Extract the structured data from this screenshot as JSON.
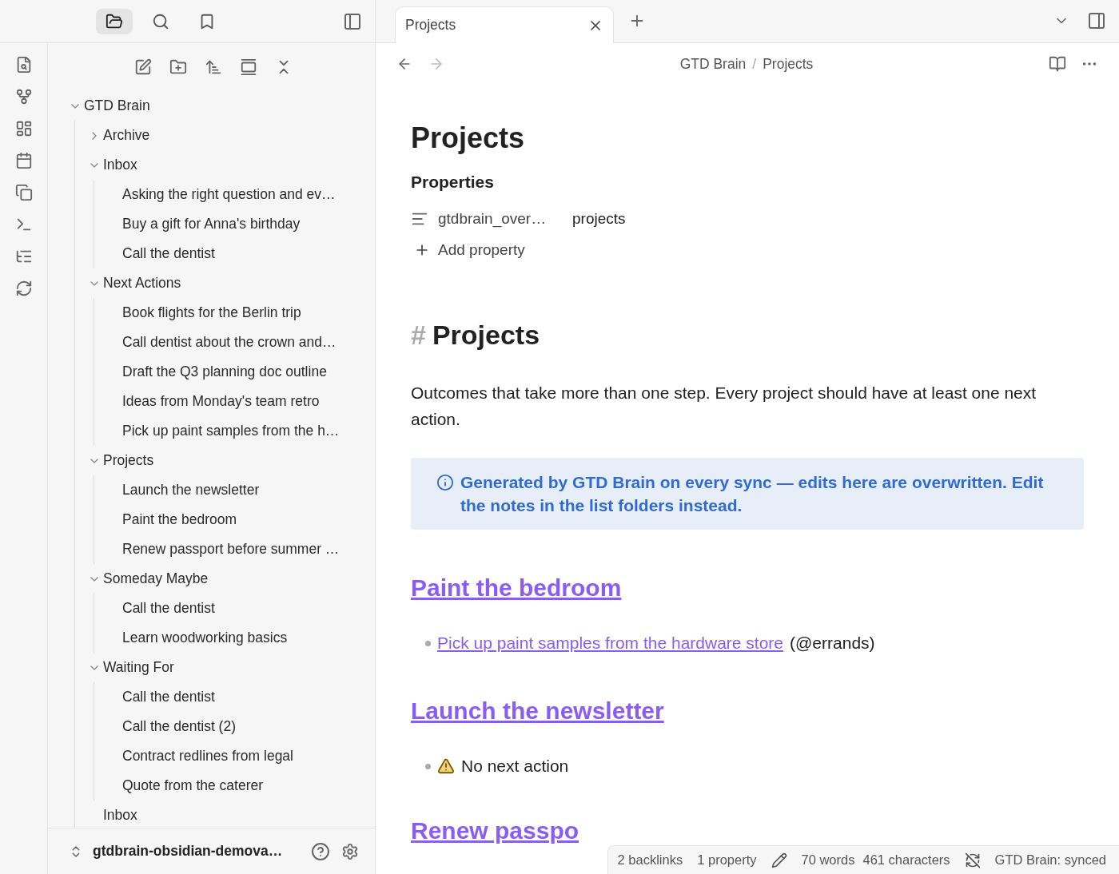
{
  "sidebar_tabs": [
    {
      "selected": true
    },
    {
      "selected": false
    },
    {
      "selected": false
    }
  ],
  "tree": [
    {
      "label": "GTD Brain",
      "kind": "folder",
      "expanded": true,
      "children": [
        {
          "label": "Archive",
          "kind": "folder",
          "expanded": false
        },
        {
          "label": "Inbox",
          "kind": "folder",
          "expanded": true,
          "children": [
            {
              "label": "Asking the right question and ev…",
              "kind": "note"
            },
            {
              "label": "Buy a gift for Anna's birthday",
              "kind": "note"
            },
            {
              "label": "Call the dentist",
              "kind": "note"
            }
          ]
        },
        {
          "label": "Next Actions",
          "kind": "folder",
          "expanded": true,
          "children": [
            {
              "label": "Book flights for the Berlin trip",
              "kind": "note"
            },
            {
              "label": "Call dentist about the crown and…",
              "kind": "note"
            },
            {
              "label": "Draft the Q3 planning doc outline",
              "kind": "note"
            },
            {
              "label": "Ideas from Monday's team retro",
              "kind": "note"
            },
            {
              "label": "Pick up paint samples from the h…",
              "kind": "note"
            }
          ]
        },
        {
          "label": "Projects",
          "kind": "folder",
          "expanded": true,
          "children": [
            {
              "label": "Launch the newsletter",
              "kind": "note"
            },
            {
              "label": "Paint the bedroom",
              "kind": "note"
            },
            {
              "label": "Renew passport before summer …",
              "kind": "note"
            }
          ]
        },
        {
          "label": "Someday Maybe",
          "kind": "folder",
          "expanded": true,
          "children": [
            {
              "label": "Call the dentist",
              "kind": "note"
            },
            {
              "label": "Learn woodworking basics",
              "kind": "note"
            }
          ]
        },
        {
          "label": "Waiting For",
          "kind": "folder",
          "expanded": true,
          "children": [
            {
              "label": "Call the dentist",
              "kind": "note"
            },
            {
              "label": "Call the dentist (2)",
              "kind": "note"
            },
            {
              "label": "Contract redlines from legal",
              "kind": "note"
            },
            {
              "label": "Quote from the caterer",
              "kind": "note"
            }
          ]
        },
        {
          "label": "Inbox",
          "kind": "note"
        }
      ]
    }
  ],
  "vault": {
    "name": "gtdbrain-obsidian-demova…"
  },
  "tabs": [
    {
      "label": "Projects",
      "selected": true
    }
  ],
  "breadcrumb": [
    "GTD Brain",
    "Projects"
  ],
  "breadcrumb_separator": "/",
  "note": {
    "title": "Projects",
    "properties_heading": "Properties",
    "properties": [
      {
        "key": "gtdbrain_over…",
        "value": "projects"
      }
    ],
    "add_property": "Add property",
    "heading_mark": "#",
    "heading": "Projects",
    "paragraph": "Outcomes that take more than one step. Every project should have at least one next action.",
    "callout": "Generated by GTD Brain on every sync — edits here are overwritten. Edit the notes in the list folders instead.",
    "sections": [
      {
        "title": "Paint the bedroom",
        "items": [
          {
            "kind": "link",
            "link": "Pick up paint samples from the hardware store",
            "text": "(@errands)"
          }
        ]
      },
      {
        "title": "Launch the newsletter",
        "items": [
          {
            "kind": "warning",
            "text": "No next action"
          }
        ]
      },
      {
        "title": "Renew passpo"
      }
    ]
  },
  "status_bar": {
    "backlinks": "2 backlinks",
    "properties": "1 property",
    "words": "70 words",
    "characters": "461 characters",
    "sync": "GTD Brain: synced"
  }
}
